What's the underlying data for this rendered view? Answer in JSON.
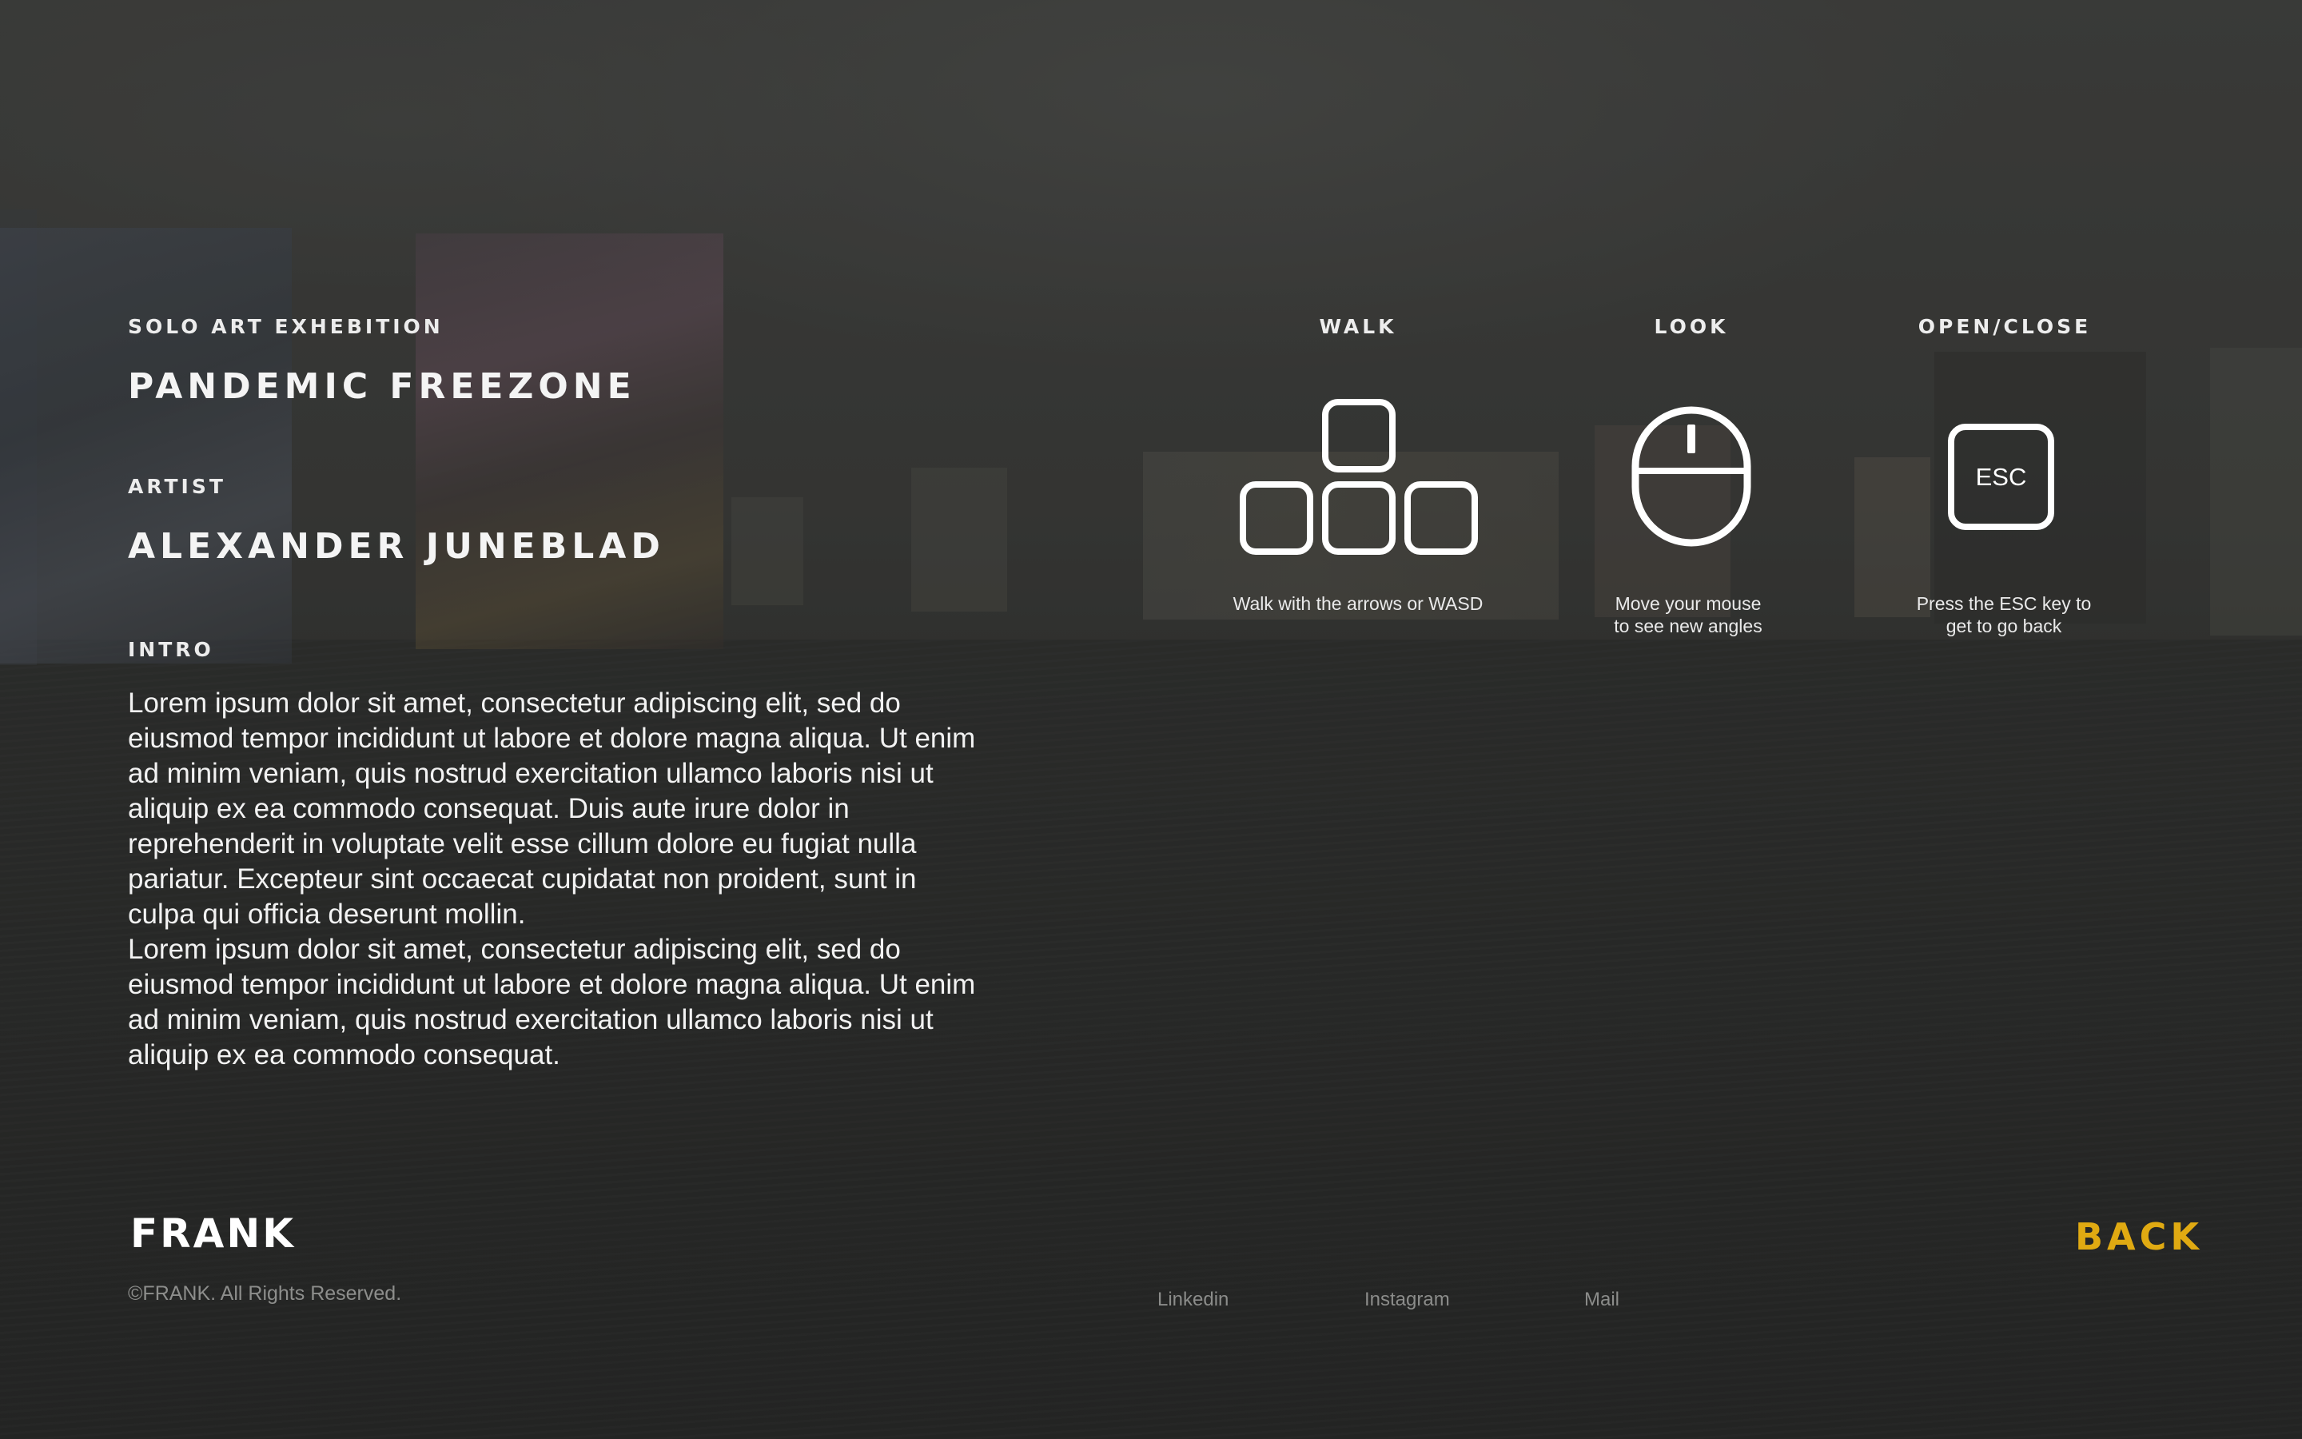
{
  "exhibition": {
    "type_label": "SOLO ART EXHEBITION",
    "title": "PANDEMIC FREEZONE",
    "artist_label": "ARTIST",
    "artist_name": "ALEXANDER JUNEBLAD",
    "intro_label": "INTRO",
    "intro_text": "Lorem ipsum dolor sit amet, consectetur adipiscing elit, sed do\neiusmod tempor incididunt ut labore et dolore magna aliqua. Ut enim\nad minim veniam, quis nostrud exercitation ullamco laboris nisi ut\naliquip ex ea commodo consequat. Duis aute irure dolor in\nreprehenderit in voluptate velit esse cillum dolore eu fugiat nulla\npariatur. Excepteur sint occaecat cupidatat non proident, sunt in\nculpa qui officia deserunt mollin.\nLorem ipsum dolor sit amet, consectetur adipiscing elit, sed do\neiusmod tempor incididunt ut labore et dolore magna aliqua. Ut enim\nad minim veniam, quis nostrud exercitation ullamco laboris nisi ut\naliquip ex ea commodo consequat."
  },
  "controls": {
    "walk": {
      "label": "WALK",
      "caption": "Walk with the arrows or WASD",
      "icon": "arrow-keys-icon"
    },
    "look": {
      "label": "LOOK",
      "caption": "Move your mouse\nto see new angles",
      "icon": "mouse-icon"
    },
    "open_close": {
      "label": "OPEN/CLOSE",
      "key": "ESC",
      "caption": "Press the ESC key to\nget to go back",
      "icon": "esc-key-icon"
    }
  },
  "footer": {
    "logo_text": "FRANK",
    "copyright": "©FRANK. All Rights Reserved.",
    "links": [
      "Linkedin",
      "Instagram",
      "Mail"
    ],
    "back_label": "BACK"
  },
  "colors": {
    "accent": "#e0aa12",
    "text": "#ffffff",
    "muted": "#8d8e8c",
    "background": "#2e2f2d"
  }
}
